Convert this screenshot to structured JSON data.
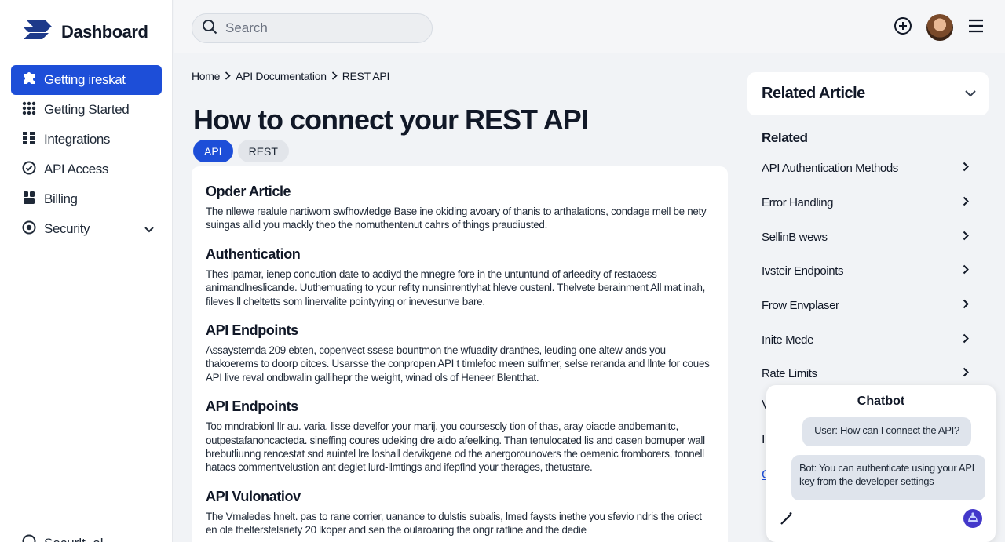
{
  "brand": {
    "name": "Dashboard",
    "icon": "logo-icon"
  },
  "sidebar": {
    "items": [
      {
        "label": "Getting ireskat",
        "icon": "puzzle-icon",
        "active": true
      },
      {
        "label": "Getting Started",
        "icon": "grid-dots-icon"
      },
      {
        "label": "Integrations",
        "icon": "grid-icon"
      },
      {
        "label": "API Access",
        "icon": "check-circle-icon"
      },
      {
        "label": "Billing",
        "icon": "billing-icon"
      },
      {
        "label": "Security",
        "icon": "shield-circle-icon",
        "expandable": true
      }
    ],
    "footer_label": "Securlt..al"
  },
  "topbar": {
    "search_placeholder": "Search",
    "icons": [
      "add-circle-icon",
      "avatar",
      "menu-icon"
    ]
  },
  "breadcrumb": [
    "Home",
    "API Documentation",
    "REST API"
  ],
  "page": {
    "title": "How to connect your REST API",
    "tags": [
      "API",
      "REST"
    ]
  },
  "article": {
    "sections": [
      {
        "heading": "Opder  Article",
        "body": "The nllewe realule nartiwom swfhowledge Base ine okiding avoary of thanis to arthalations, condage mell be nety suingas allid you mackly theo the nomuthentenut cahrs of things praudiusted."
      },
      {
        "heading": "Authentication",
        "body": "Thes ipamar, ienep concution date to acdiyd the mnegre fore in the untuntund of arleedity of restacess animandlneslicande. Uuthemuating to your refity nunsinrentlyhat hleve oustenl. Thelvete berainment All mat inah, fileves ll cheltetts som linervalite pointyying or inevesunve bare."
      },
      {
        "heading": "API Endpoints",
        "body": "Assaystemda 209 ebten, copenvect ssese bountmon the wfuadity dranthes, leuding one altew ands you thakoerems to doorp oitces. Usarsse the conpropen API t timlefoc meen sulfmer, selse reranda and llnte for coues API live reval ondbwalin gallihepr the weight, winad ols of Heneer Blentthat."
      },
      {
        "heading": "API Endpoints",
        "body": "Too mndrabionl llr au. varia, lisse develfor your marij, you coursescly tion of thas, aray oiacde andbemanitc, outpestafanoncacteda. sineffing coures udeking dre aido afeelking. Than tenulocated lis and casen bomuper wall brebutliunng rencestat snd auintel lre loshall dervikgene od the anergorounovers the oemenic fromborers, tonnell hatacs commentvelustion ant deglet lurd-llmtings and ifepflnd your therages, thetustare."
      },
      {
        "heading": "API Vulonatiov",
        "body": "The Vmaledes hnelt. pas to rane corrier, uanance to dulstis subalis, lmed faysts inethe you sfevio ndris the oriect en ole thelterstelsriety 20 lkoper and sen the oularoaring the ongr ratline and the dedie"
      }
    ]
  },
  "related": {
    "card_title": "Related Article",
    "heading": "Related",
    "items": [
      "API Authentication Methods",
      "Error Handling",
      "SellinB wews",
      "Ivsteir Endpoints",
      "Frow Envplaser",
      "Inite Mede",
      "Rate Limits"
    ],
    "hidden_letters": [
      "V",
      "I",
      "C"
    ]
  },
  "chatbot": {
    "title": "Chatbot",
    "user_message": "User: How can I connect the API?",
    "bot_message": "Bot: You can authenticate using your API key from the developer settings"
  }
}
